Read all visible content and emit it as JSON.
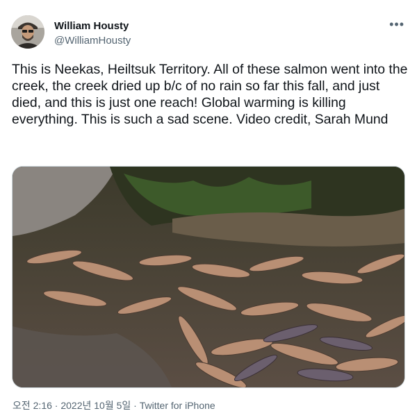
{
  "author": {
    "display_name": "William Housty",
    "handle": "@WilliamHousty"
  },
  "more_icon": "more-horizontal-icon",
  "tweet_text": "This is Neekas, Heiltsuk Territory. All of these salmon went into the creek, the creek dried up b/c of no rain so far this fall, and just died, and this is just one reach! Global warming is killing everything. This is such a sad scene. Video credit, Sarah Mund",
  "media": {
    "type": "video-thumbnail"
  },
  "footer": {
    "time": "오전 2:16",
    "separator": " · ",
    "date": "2022년 10월 5일",
    "source": "Twitter for iPhone"
  },
  "colors": {
    "text_primary": "#0f1419",
    "text_secondary": "#536471",
    "border": "#cfd9de"
  }
}
